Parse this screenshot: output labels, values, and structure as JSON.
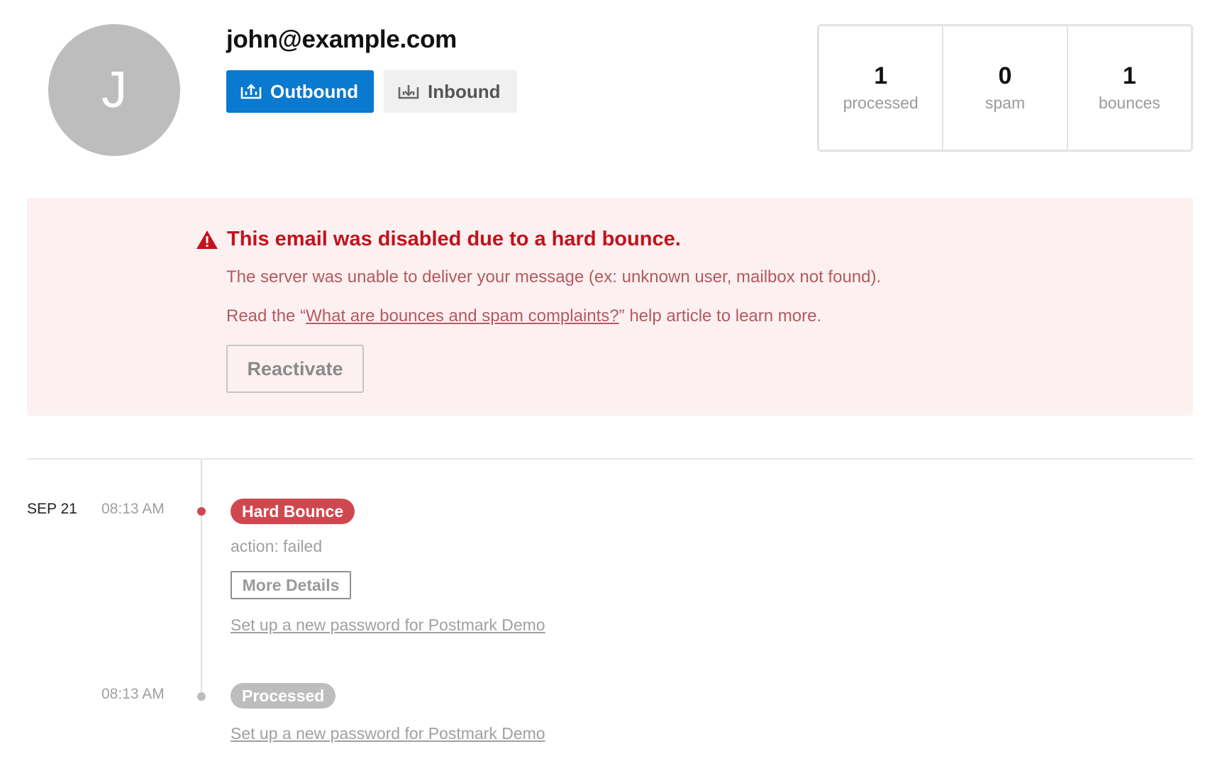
{
  "header": {
    "avatar_letter": "J",
    "email": "john@example.com",
    "outbound_label": "Outbound",
    "inbound_label": "Inbound"
  },
  "stats": [
    {
      "value": "1",
      "label": "processed"
    },
    {
      "value": "0",
      "label": "spam"
    },
    {
      "value": "1",
      "label": "bounces"
    }
  ],
  "alert": {
    "title": "This email was disabled due to a hard bounce.",
    "description": "The server was unable to deliver your message (ex: unknown user, mailbox not found).",
    "read_prefix": "Read the “",
    "link_text": "What are bounces and spam complaints?",
    "read_suffix": "” help article to learn more.",
    "reactivate_label": "Reactivate"
  },
  "timeline": {
    "date": "SEP 21",
    "events": [
      {
        "time": "08:13 AM",
        "badge": "Hard Bounce",
        "meta": "action: failed",
        "details_label": "More Details",
        "subject": "Set up a new password for Postmark Demo"
      },
      {
        "time": "08:13 AM",
        "badge": "Processed",
        "subject": "Set up a new password for Postmark Demo"
      }
    ]
  },
  "colors": {
    "primary": "#0a79d0",
    "danger": "#c2121b",
    "danger_bg": "#fcf0f1",
    "badge_hard": "#d0484f",
    "badge_processed": "#bdbdbd"
  }
}
